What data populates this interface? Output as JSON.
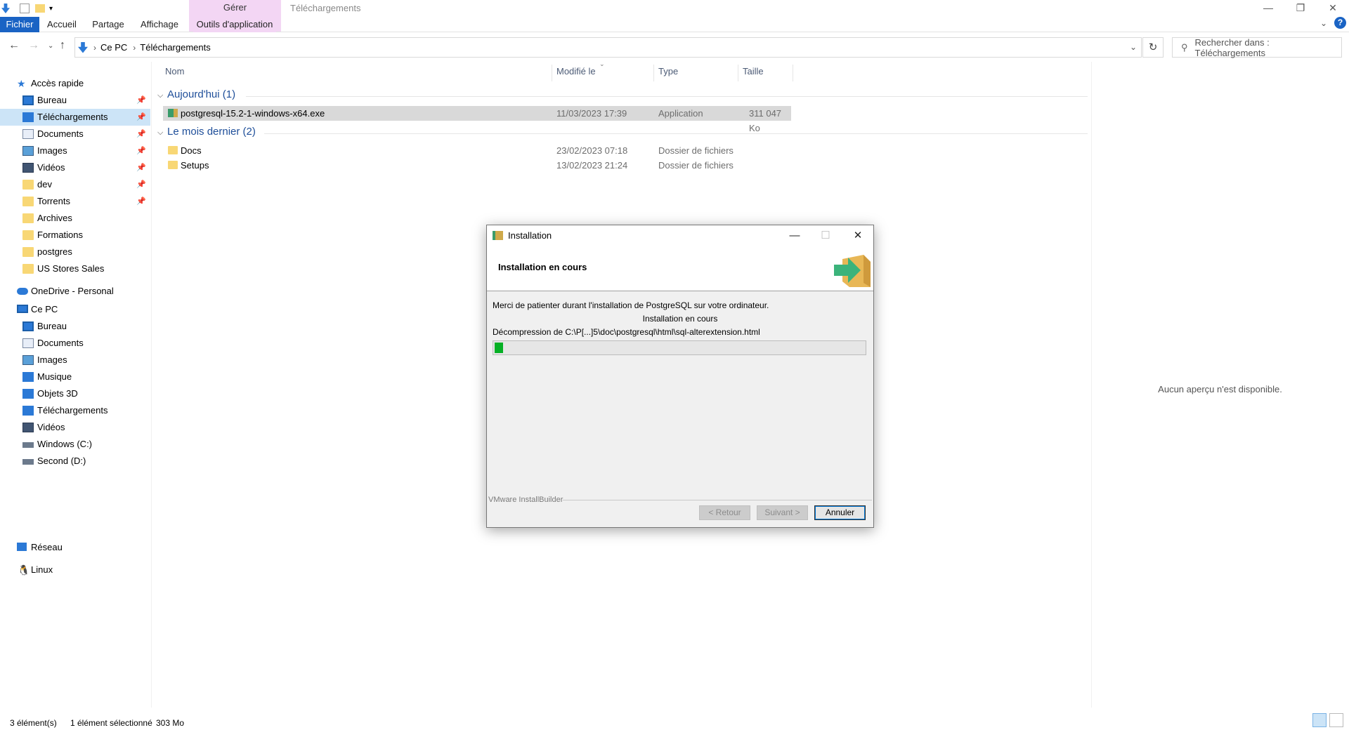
{
  "window": {
    "title": "Téléchargements",
    "context_group": "Gérer",
    "buttons": {
      "minimize": "—",
      "restore": "❐",
      "close": "✕"
    }
  },
  "ribbon": {
    "tabs": [
      "Fichier",
      "Accueil",
      "Partage",
      "Affichage",
      "Outils d'application"
    ],
    "collapse": "⌄",
    "help": "?"
  },
  "address": {
    "crumbs": [
      "Ce PC",
      "Téléchargements"
    ],
    "separator": "›",
    "search_placeholder": "Rechercher dans : Téléchargements"
  },
  "nav": {
    "quick_access": "Accès rapide",
    "quick_items": [
      {
        "label": "Bureau",
        "pinned": true,
        "icon": "desktop-icon"
      },
      {
        "label": "Téléchargements",
        "pinned": true,
        "icon": "download-icon"
      },
      {
        "label": "Documents",
        "pinned": true,
        "icon": "documents-icon"
      },
      {
        "label": "Images",
        "pinned": true,
        "icon": "pictures-icon"
      },
      {
        "label": "Vidéos",
        "pinned": true,
        "icon": "videos-icon"
      },
      {
        "label": "dev",
        "pinned": true,
        "icon": "folder-icon"
      },
      {
        "label": "Torrents",
        "pinned": true,
        "icon": "folder-icon"
      },
      {
        "label": "Archives",
        "pinned": false,
        "icon": "folder-icon"
      },
      {
        "label": "Formations",
        "pinned": false,
        "icon": "folder-icon"
      },
      {
        "label": "postgres",
        "pinned": false,
        "icon": "folder-icon"
      },
      {
        "label": "US Stores Sales",
        "pinned": false,
        "icon": "folder-icon"
      }
    ],
    "onedrive": "OneDrive - Personal",
    "this_pc": "Ce PC",
    "pc_items": [
      "Bureau",
      "Documents",
      "Images",
      "Musique",
      "Objets 3D",
      "Téléchargements",
      "Vidéos",
      "Windows (C:)",
      "Second (D:)"
    ],
    "network": "Réseau",
    "linux": "Linux"
  },
  "columns": [
    "Nom",
    "Modifié le",
    "Type",
    "Taille"
  ],
  "groups": [
    {
      "label": "Aujourd'hui (1)",
      "files": [
        {
          "name": "postgresql-15.2-1-windows-x64.exe",
          "modified": "11/03/2023 17:39",
          "type": "Application",
          "size": "311 047 Ko",
          "selected": true
        }
      ]
    },
    {
      "label": "Le mois dernier (2)",
      "files": [
        {
          "name": "Docs",
          "modified": "23/02/2023 07:18",
          "type": "Dossier de fichiers",
          "size": ""
        },
        {
          "name": "Setups",
          "modified": "13/02/2023 21:24",
          "type": "Dossier de fichiers",
          "size": ""
        }
      ]
    }
  ],
  "preview_text": "Aucun aperçu n'est disponible.",
  "status": {
    "count": "3 élément(s)",
    "selection": "1 élément sélectionné",
    "size": "303 Mo"
  },
  "dialog": {
    "title": "Installation",
    "header": "Installation en cours",
    "message": "Merci de patienter durant l'installation de PostgreSQL sur votre ordinateur.",
    "stage": "Installation en cours",
    "detail": "Décompression de C:\\P[...]5\\doc\\postgresql\\html\\sql-alterextension.html",
    "progress_fraction": 0.02,
    "brand": "VMware InstallBuilder",
    "back": "< Retour",
    "next": "Suivant >",
    "cancel": "Annuler"
  },
  "colors": {
    "accent": "#1a63c4",
    "progress": "#06b025",
    "context_tab": "#f3d6f4"
  }
}
